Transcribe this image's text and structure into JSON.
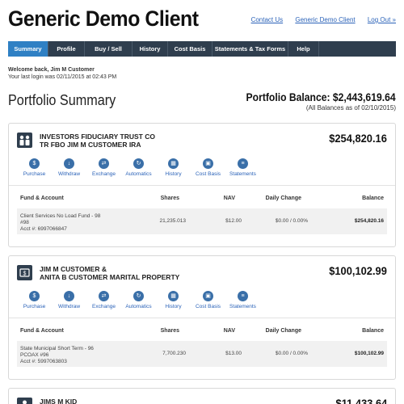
{
  "header": {
    "title": "Generic Demo Client",
    "links": [
      "Contact Us",
      "Generic Demo Client",
      "Log Out »"
    ]
  },
  "nav": {
    "items": [
      "Summary",
      "Profile",
      "Buy / Sell",
      "History",
      "Cost Basis",
      "Statements & Tax Forms",
      "Help"
    ],
    "active": "Summary"
  },
  "welcome": {
    "greeting": "Welcome back, Jim M Customer",
    "last_login": "Your last login was 02/11/2015 at 02:43 PM"
  },
  "summary": {
    "title": "Portfolio Summary",
    "balance": "Portfolio Balance: $2,443,619.64",
    "as_of": "(All Balances as of 02/10/2015)"
  },
  "actions": [
    "Purchase",
    "Withdraw",
    "Exchange",
    "Automatics",
    "History",
    "Cost Basis",
    "Statements"
  ],
  "table_headers": [
    "Fund & Account",
    "Shares",
    "NAV",
    "Daily Change",
    "Balance"
  ],
  "accounts": [
    {
      "name_line1": "INVESTORS FIDUCIARY TRUST CO",
      "name_line2": "TR FBO JIM M CUSTOMER IRA",
      "value": "$254,820.16",
      "row": {
        "fund_line1": "Client Services No Load Fund - 98",
        "fund_line2": "#98",
        "fund_line3": "Acct #: 6997066847",
        "shares": "21,235.013",
        "nav": "$12.00",
        "change": "$0.00 / 0.00%",
        "balance": "$254,820.16"
      }
    },
    {
      "name_line1": "JIM M CUSTOMER &",
      "name_line2": "ANITA B CUSTOMER MARITAL PROPERTY",
      "value": "$100,102.99",
      "row": {
        "fund_line1": "State Municipal Short Term - 96",
        "fund_line2": "PCOAX #96",
        "fund_line3": "Acct #: 5997063803",
        "shares": "7,700.230",
        "nav": "$13.00",
        "change": "$0.00 / 0.00%",
        "balance": "$100,102.99"
      }
    },
    {
      "name_line1": "JIMS M KID",
      "value": "$11,433.64"
    }
  ]
}
